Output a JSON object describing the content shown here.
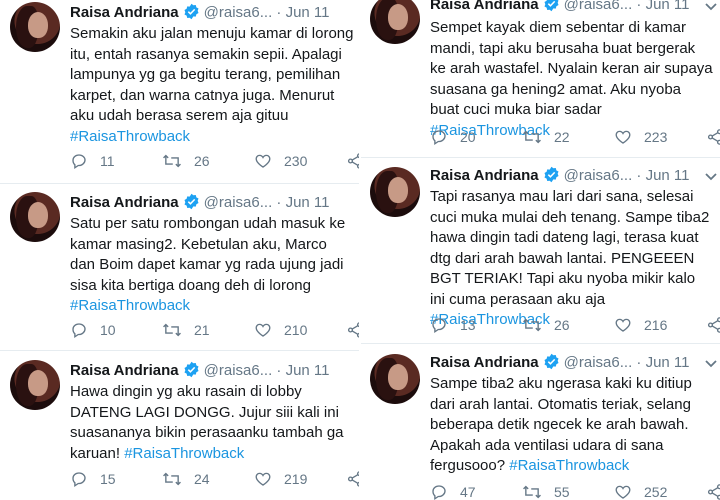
{
  "colors": {
    "hashtag": "#1b95e0",
    "verified": "#1da1f2",
    "muted": "#657786"
  },
  "user": {
    "name": "Raisa Andriana",
    "handle": "@raisa6...",
    "date": "· Jun 11"
  },
  "left": [
    {
      "text": "Semakin aku jalan menuju kamar di lorong itu, entah rasanya semakin sepii. Apalagi lampunya yg ga begitu terang, pemilihan karpet, dan warna catnya juga. Menurut aku udah berasa serem aja gituu",
      "hashtag": "#RaisaThrowback",
      "replies": "11",
      "retweets": "26",
      "likes": "230"
    },
    {
      "text": "Satu per satu rombongan udah masuk ke kamar masing2. Kebetulan aku, Marco dan Boim dapet kamar yg rada ujung jadi sisa kita bertiga doang deh di lorong",
      "hashtag": "#RaisaThrowback",
      "replies": "10",
      "retweets": "21",
      "likes": "210"
    },
    {
      "text": "Hawa dingin yg aku rasain di lobby DATENG LAGI DONGG. Jujur siii kali ini suasananya bikin perasaanku tambah ga karuan!",
      "hashtag": "#RaisaThrowback",
      "replies": "15",
      "retweets": "24",
      "likes": "219"
    }
  ],
  "right": [
    {
      "text": "Sempet kayak diem sebentar di kamar mandi, tapi aku berusaha buat bergerak ke arah wastafel. Nyalain keran air supaya suasana ga hening2 amat. Aku nyoba buat cuci muka biar sadar",
      "hashtag": "#RaisaThrowback",
      "replies": "20",
      "retweets": "22",
      "likes": "223"
    },
    {
      "text": "Tapi rasanya mau lari dari sana, selesai cuci muka mulai deh tenang. Sampe tiba2 hawa dingin tadi dateng lagi, terasa kuat dtg dari arah bawah lantai. PENGEEEN BGT TERIAK! Tapi aku nyoba mikir kalo ini cuma perasaan aku aja",
      "hashtag": "#RaisaThrowback",
      "replies": "13",
      "retweets": "26",
      "likes": "216"
    },
    {
      "text": "Sampe tiba2 aku ngerasa kaki ku ditiup dari arah lantai. Otomatis teriak, selang beberapa detik ngecek ke arah bawah. Apakah ada ventilasi udara di sana fergusooo?",
      "hashtag": "#RaisaThrowback",
      "replies": "47",
      "retweets": "55",
      "likes": "252"
    }
  ]
}
